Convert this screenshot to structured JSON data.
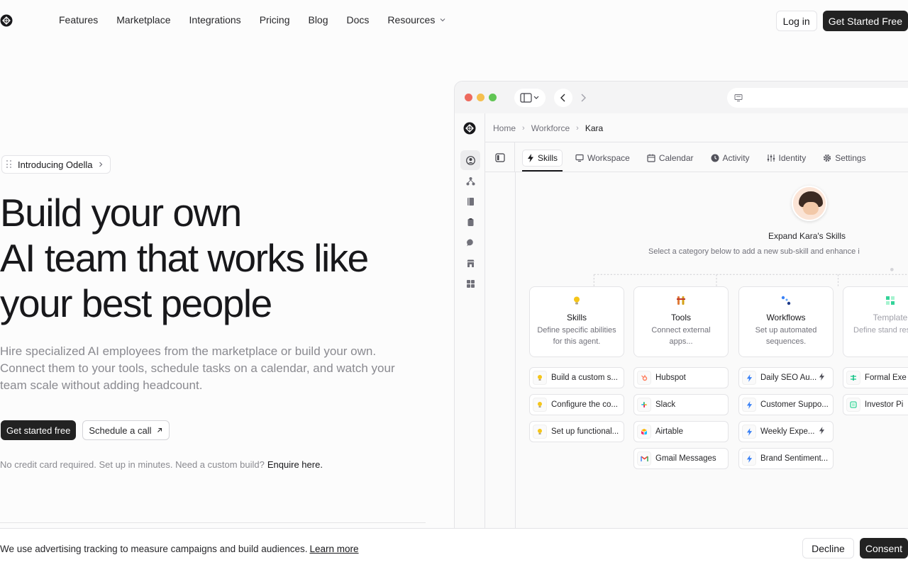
{
  "nav": {
    "links": [
      "Features",
      "Marketplace",
      "Integrations",
      "Pricing",
      "Blog",
      "Docs",
      "Resources"
    ],
    "login": "Log in",
    "cta": "Get Started Free"
  },
  "hero": {
    "pill": "Introducing Odella",
    "title_lines": [
      "Build your own",
      "AI team that works like",
      "your best people"
    ],
    "subtitle": "Hire specialized AI employees from the marketplace or build your own. Connect them to your tools, schedule tasks on a calendar, and watch your team scale without adding headcount.",
    "primary_cta": "Get started free",
    "secondary_cta": "Schedule a call",
    "fine_print": "No credit card required. Set up in minutes. Need a custom build?",
    "enquire": "Enquire here."
  },
  "app": {
    "breadcrumb": [
      "Home",
      "Workforce",
      "Kara"
    ],
    "tabs": [
      "Skills",
      "Workspace",
      "Calendar",
      "Activity",
      "Identity",
      "Settings"
    ],
    "expand_title": "Expand Kara's Skills",
    "expand_sub": "Select a category below to add a new sub-skill and enhance i",
    "cards": [
      {
        "title": "Skills",
        "desc": "Define specific abilities for this agent."
      },
      {
        "title": "Tools",
        "desc": "Connect external apps..."
      },
      {
        "title": "Workflows",
        "desc": "Set up automated sequences."
      },
      {
        "title": "Template",
        "desc": "Define stand respons"
      }
    ],
    "skills_items": [
      "Build a custom s...",
      "Configure the co...",
      "Set up functional..."
    ],
    "tools_items": [
      "Hubspot",
      "Slack",
      "Airtable",
      "Gmail Messages"
    ],
    "workflow_items": [
      "Daily SEO Au...",
      "Customer Suppo...",
      "Weekly Expe...",
      "Brand Sentiment..."
    ],
    "template_items": [
      "Formal Exe",
      "Investor Pi"
    ]
  },
  "cookie": {
    "text": "We use advertising tracking to measure campaigns and build audiences.",
    "learn_more": "Learn more",
    "decline": "Decline",
    "consent": "Consent"
  }
}
